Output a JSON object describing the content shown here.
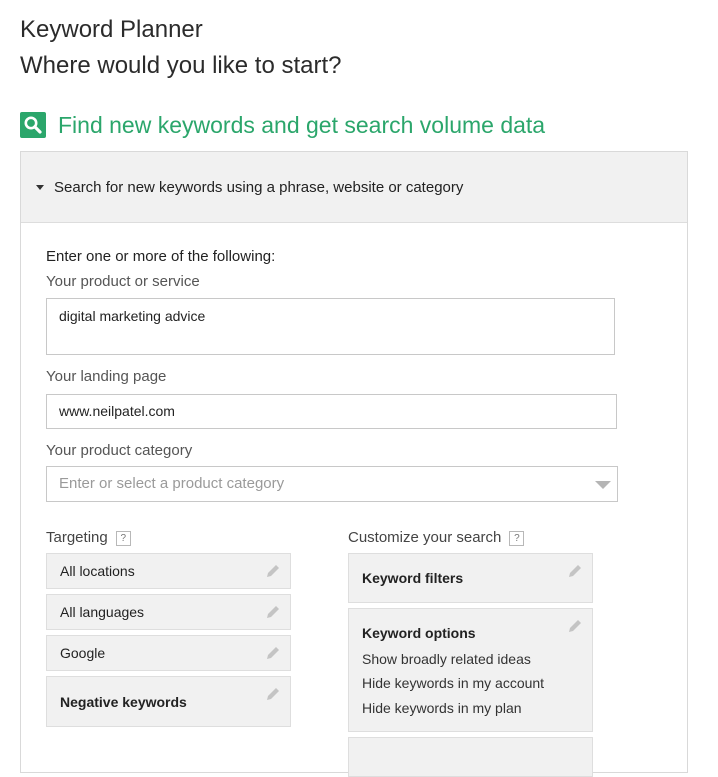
{
  "header": {
    "title": "Keyword Planner",
    "subtitle": "Where would you like to start?"
  },
  "section": {
    "icon": "search-icon",
    "title": "Find new keywords and get search volume data",
    "accent_color": "#2ba66b"
  },
  "panel": {
    "header_label": "Search for new keywords using a phrase, website or category",
    "intro": "Enter one or more of the following:",
    "product": {
      "label": "Your product or service",
      "value": "digital marketing advice"
    },
    "landing": {
      "label": "Your landing page",
      "value": "www.neilpatel.com"
    },
    "category": {
      "label": "Your product category",
      "placeholder": "Enter or select a product category"
    },
    "targeting": {
      "label": "Targeting",
      "help": "?",
      "items": [
        {
          "label": "All locations"
        },
        {
          "label": "All languages"
        },
        {
          "label": "Google"
        },
        {
          "label": "Negative keywords"
        }
      ]
    },
    "customize": {
      "label": "Customize your search",
      "help": "?",
      "filters_label": "Keyword filters",
      "options_label": "Keyword options",
      "options_items": [
        "Show broadly related ideas",
        "Hide keywords in my account",
        "Hide keywords in my plan"
      ]
    }
  }
}
